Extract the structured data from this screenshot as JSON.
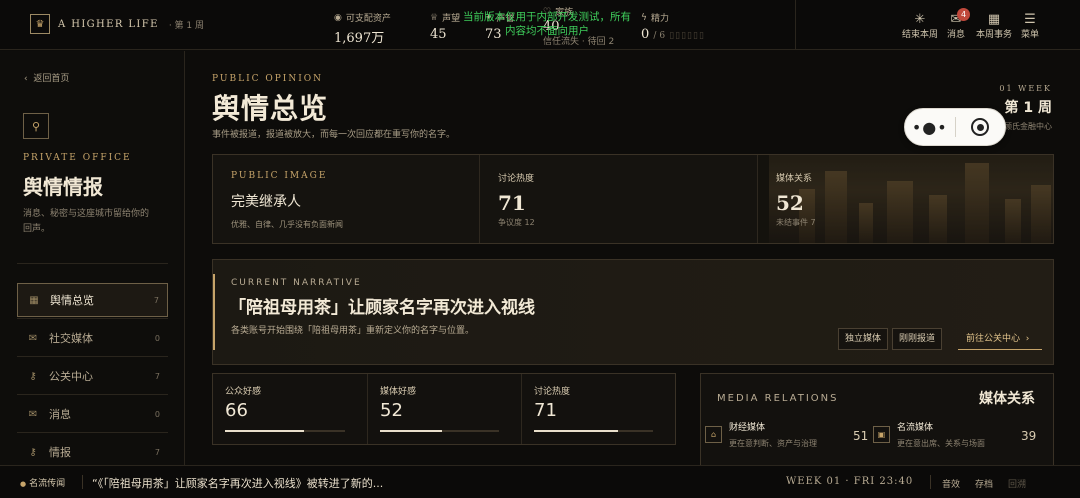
{
  "topbar": {
    "brand": "A HIGHER LIFE",
    "brand_icon": "crown-icon",
    "week": "· 第 1 周",
    "stats": [
      {
        "icon": "coin-icon",
        "label": "可支配资产",
        "value": "1,697万"
      },
      {
        "icon": "crown-icon",
        "label": "声望",
        "value": "45"
      },
      {
        "icon": "star-icon",
        "label": "声誉",
        "value": "73"
      },
      {
        "icon": "heart-icon",
        "label": "家族",
        "value": "40",
        "sub": "信任流失 · 待回 2"
      },
      {
        "icon": "bolt-icon",
        "label": "精力",
        "value": "0",
        "sub": "/ 6"
      }
    ],
    "dev_notice": "当前版本仅用于内部开发测试，所有内容均不面向用户",
    "buttons": [
      {
        "icon": "sparkle-icon",
        "label": "结束本周"
      },
      {
        "icon": "mail-icon",
        "label": "消息",
        "badge": "4"
      },
      {
        "icon": "calendar-icon",
        "label": "本周事务"
      },
      {
        "icon": "menu-icon",
        "label": "菜单"
      }
    ]
  },
  "sidebar": {
    "back": "返回首页",
    "kicker": "PRIVATE OFFICE",
    "title": "舆情情报",
    "desc": "消息、秘密与这座城市留给你的回声。",
    "items": [
      {
        "icon": "grid-icon",
        "label": "舆情总览",
        "count": "7",
        "active": true
      },
      {
        "icon": "mail-icon",
        "label": "社交媒体",
        "count": "0"
      },
      {
        "icon": "key-icon",
        "label": "公关中心",
        "count": "7"
      },
      {
        "icon": "mail-icon",
        "label": "消息",
        "count": "0"
      },
      {
        "icon": "key-icon",
        "label": "情报",
        "count": "7"
      }
    ]
  },
  "main": {
    "kicker": "PUBLIC OPINION",
    "title": "舆情总览",
    "desc": "事件被报道，报道被放大，而每一次回应都在重写你的名字。",
    "week_en": "01 WEEK",
    "week_cn": "第 1 周",
    "location": "顾氏金融中心",
    "public_image": {
      "kicker": "PUBLIC IMAGE",
      "title": "完美继承人",
      "sub": "优雅、自律、几乎没有负面新闻"
    },
    "heat": {
      "label": "讨论热度",
      "value": "71",
      "sub": "争议度 12"
    },
    "media_rel": {
      "label": "媒体关系",
      "value": "52",
      "sub": "未结事件 7"
    },
    "narrative": {
      "kicker": "CURRENT NARRATIVE",
      "title": "「陪祖母用茶」让顾家名字再次进入视线",
      "desc": "各类账号开始围绕「陪祖母用茶」重新定义你的名字与位置。",
      "tags": [
        "独立媒体",
        "刚刚报道"
      ],
      "goto": "前往公关中心"
    },
    "metrics": [
      {
        "label": "公众好感",
        "value": "66",
        "pct": 66
      },
      {
        "label": "媒体好感",
        "value": "52",
        "pct": 52
      },
      {
        "label": "讨论热度",
        "value": "71",
        "pct": 71
      }
    ],
    "media": {
      "kicker": "MEDIA RELATIONS",
      "title": "媒体关系",
      "items": [
        {
          "icon": "building-icon",
          "name": "财经媒体",
          "desc": "更在意判断、资产与治理",
          "score": "51"
        },
        {
          "icon": "camera-icon",
          "name": "名流媒体",
          "desc": "更在意出席、关系与场面",
          "score": "39"
        }
      ]
    }
  },
  "bottombar": {
    "ticker_label": "名流传闻",
    "ticker_text": "“《「陪祖母用茶」让顾家名字再次进入视线》被转进了新的...",
    "clock": "WEEK 01 · FRI  23:40",
    "buttons": [
      "音效",
      "存档",
      "回溯"
    ]
  }
}
